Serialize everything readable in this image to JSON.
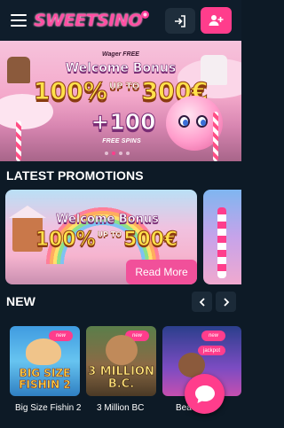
{
  "header": {
    "logo_text": "SWEETSINO",
    "icons": {
      "menu": "hamburger-icon",
      "login": "login-icon",
      "register": "add-user-icon"
    },
    "accent": "#ff3d8c"
  },
  "hero": {
    "wager": "Wager FREE",
    "title": "Welcome Bonus",
    "percent": "100%",
    "upto": "UP TO",
    "amount": "300€",
    "spins": "+100",
    "spins_label": "FREE SPINS",
    "slides": 4,
    "active_slide": 2
  },
  "promotions": {
    "heading": "LATEST PROMOTIONS",
    "cards": [
      {
        "title": "Welcome Bonus",
        "percent": "100%",
        "upto": "UP TO",
        "amount": "500€",
        "button": "Read More"
      }
    ]
  },
  "new_games": {
    "heading": "NEW",
    "prev_icon": "chevron-left-icon",
    "next_icon": "chevron-right-icon",
    "games": [
      {
        "name": "Big Size Fishin 2",
        "art_line1": "BIG SIZE",
        "art_line2": "FISHIN 2",
        "badge": "new"
      },
      {
        "name": "3 Million BC",
        "art_line1": "3 MILLION",
        "art_line2": "B.C.",
        "badge": "new"
      },
      {
        "name": "Bea",
        "art_line1": "Bea",
        "badge": "new",
        "badge2": "jackpot"
      }
    ]
  },
  "chat": {
    "icon": "chat-bubble-icon"
  }
}
